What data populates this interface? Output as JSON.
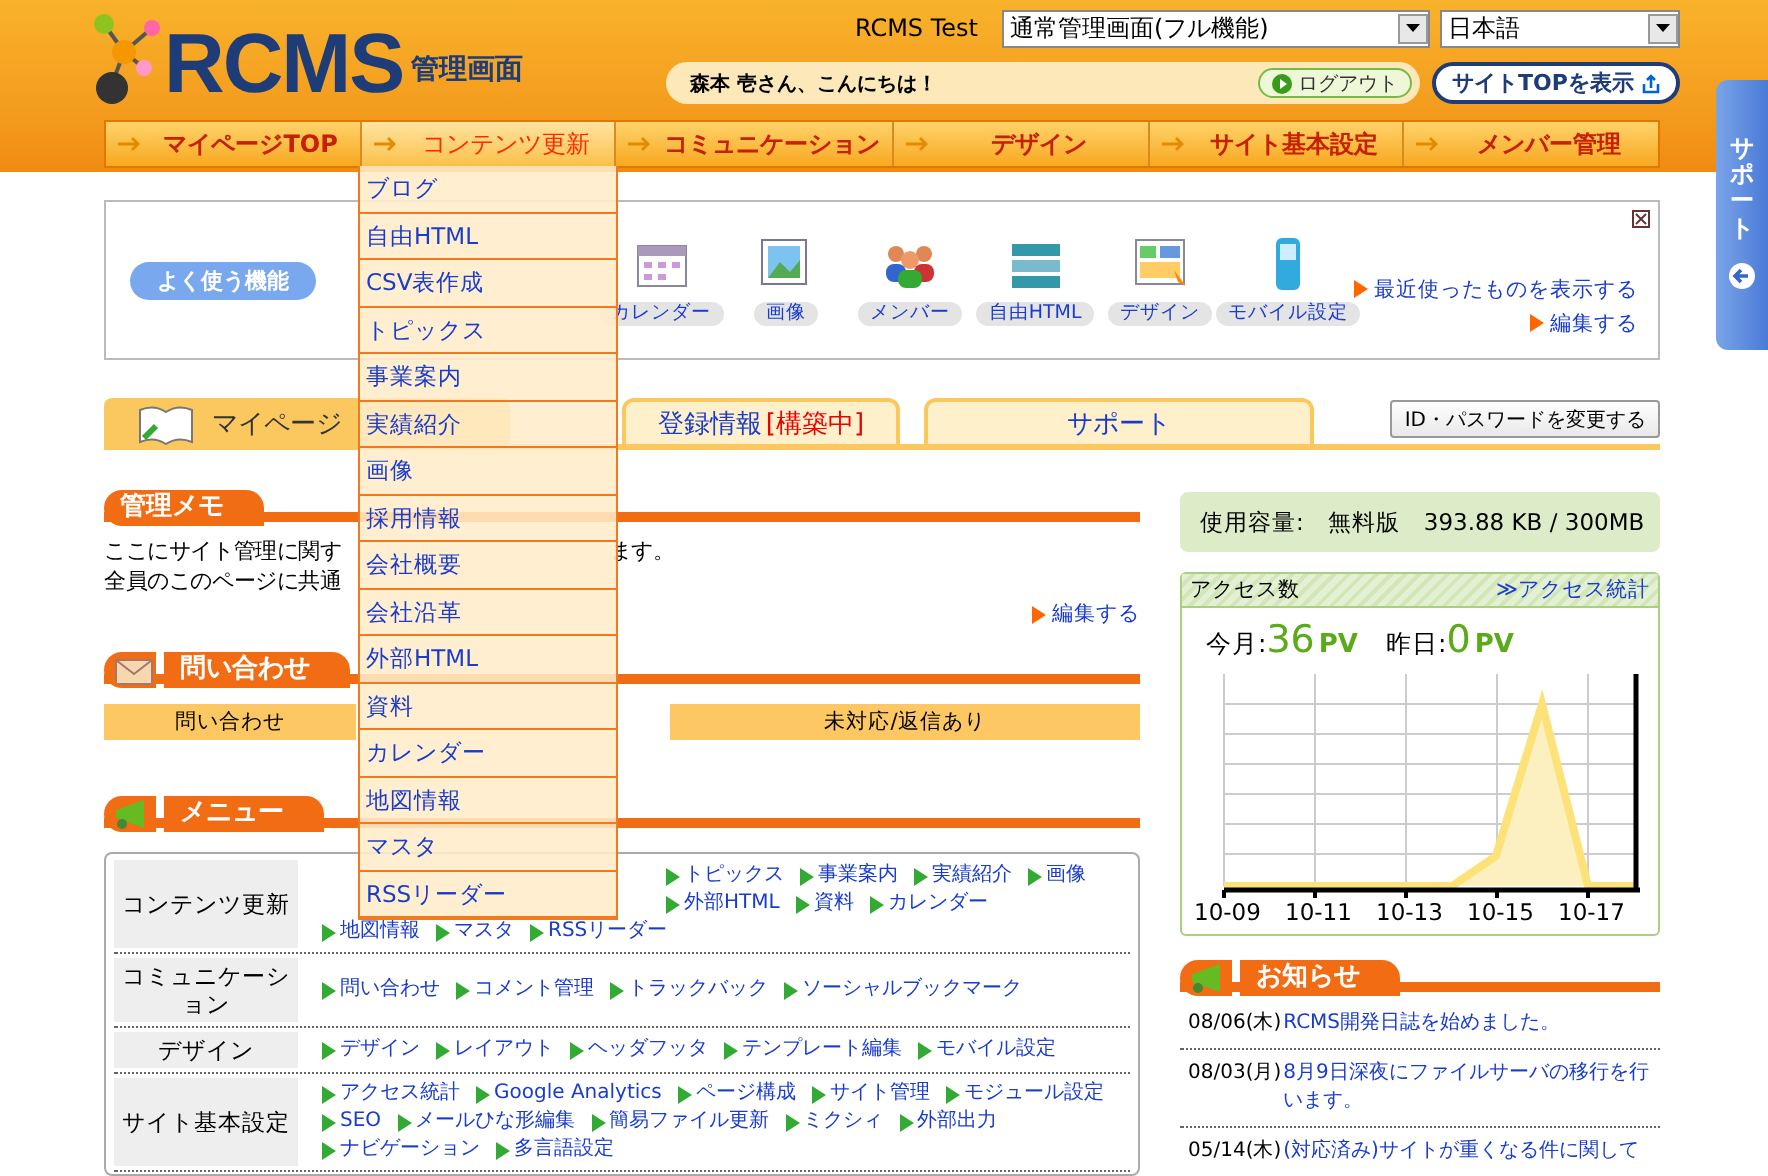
{
  "header": {
    "logo_text": "RCMS",
    "logo_subtitle": "管理画面",
    "site_name": "RCMS Test",
    "mode_select": "通常管理画面(フル機能)",
    "language_select": "日本語",
    "greeting": "森本 壱さん、こんにちは！",
    "logout_button": "ログアウト",
    "site_top_button": "サイトTOPを表示"
  },
  "nav": [
    {
      "label": "マイページTOP",
      "selected": false
    },
    {
      "label": "コンテンツ更新",
      "selected": true,
      "expanded": true,
      "submenu": [
        "ブログ",
        "自由HTML",
        "CSV表作成",
        "トピックス",
        "事業案内",
        "実績紹介",
        "画像",
        "採用情報",
        "会社概要",
        "会社沿革",
        "外部HTML",
        "資料",
        "カレンダー",
        "地図情報",
        "マスタ",
        "RSSリーダー"
      ]
    },
    {
      "label": "コミュニケーション",
      "selected": false
    },
    {
      "label": "デザイン",
      "selected": false
    },
    {
      "label": "サイト基本設定",
      "selected": false
    },
    {
      "label": "メンバー管理",
      "selected": false
    }
  ],
  "side_tab": {
    "label": "サポート"
  },
  "shortcuts": {
    "title": "よく使う機能",
    "items": [
      "カレンダー",
      "画像",
      "メンバー",
      "自由HTML",
      "デザイン",
      "モバイル設定"
    ],
    "links": [
      "最近使ったものを表示する",
      "編集する"
    ]
  },
  "tabs": [
    {
      "label": "マイページ",
      "selected": true
    },
    {
      "label": "登録情報",
      "status": "[構築中]",
      "selected": false
    },
    {
      "label": "サポート",
      "selected": false
    }
  ],
  "password_button": "ID・パスワードを変更する",
  "memo": {
    "title": "管理メモ",
    "lines": [
      [
        "ここにサイト管理に関す",
        "ます。"
      ],
      [
        "全員のこのページに共通"
      ]
    ],
    "edit_link": "編集する"
  },
  "inquiries": {
    "title": "問い合わせ",
    "columns": [
      "問い合わせ",
      "未対応/返信あり"
    ]
  },
  "menu": {
    "title": "メニュー",
    "sections": [
      {
        "category": "コンテンツ更新",
        "lines": [
          [
            "トピックス",
            "事業案内",
            "実績紹介",
            "画像"
          ],
          [
            "外部HTML",
            "資料",
            "カレンダー"
          ],
          [
            "地図情報",
            "マスタ",
            "RSSリーダー"
          ]
        ]
      },
      {
        "category": "コミュニケーション",
        "lines": [
          [
            "問い合わせ",
            "コメント管理",
            "トラックバック",
            "ソーシャルブックマーク"
          ]
        ]
      },
      {
        "category": "デザイン",
        "lines": [
          [
            "デザイン",
            "レイアウト",
            "ヘッダフッタ",
            "テンプレート編集",
            "モバイル設定"
          ]
        ]
      },
      {
        "category": "サイト基本設定",
        "lines": [
          [
            "アクセス統計",
            "Google Analytics",
            "ページ構成",
            "サイト管理",
            "モジュール設定"
          ],
          [
            "SEO",
            "メールひな形編集",
            "簡易ファイル更新",
            "ミクシィ",
            "外部出力"
          ],
          [
            "ナビゲーション",
            "多言語設定"
          ]
        ]
      }
    ]
  },
  "usage": {
    "label": "使用容量:",
    "plan": "無料版",
    "amount": "393.88 KB / 300MB"
  },
  "access": {
    "title": "アクセス数",
    "link": "≫アクセス統計",
    "month_label": "今月:",
    "month_value": "36",
    "month_unit": "PV",
    "day_label": "昨日:",
    "day_value": "0",
    "day_unit": "PV",
    "x_labels": [
      "10-09",
      "10-11",
      "10-13",
      "10-15",
      "10-17"
    ]
  },
  "news": {
    "title": "お知らせ",
    "items": [
      {
        "date": "08/06(木)",
        "text": "RCMS開発日誌を始めました。"
      },
      {
        "date": "08/03(月)",
        "text": "8月9日深夜にファイルサーバの移行を行います。"
      },
      {
        "date": "05/14(木)",
        "text": "(対応済み)サイトが重くなる件に関して"
      }
    ]
  }
}
